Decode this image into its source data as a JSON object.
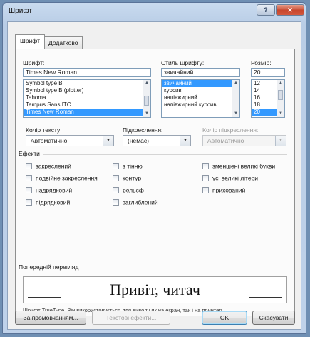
{
  "window": {
    "title": "Шрифт",
    "help_label": "?",
    "close_label": "✕"
  },
  "tabs": [
    {
      "label": "Шрифт"
    },
    {
      "label": "Додатково"
    }
  ],
  "font": {
    "label": "Шрифт:",
    "value": "Times New Roman",
    "items": [
      "Symbol type B",
      "Symbol type B (plotter)",
      "Tahoma",
      "Tempus Sans ITC",
      "Times New Roman"
    ],
    "selected_index": 4
  },
  "style": {
    "label": "Стиль шрифту:",
    "value": "звичайний",
    "items": [
      "звичайний",
      "курсив",
      "напівжирний",
      "напівжирний курсив"
    ],
    "selected_index": 0
  },
  "size": {
    "label": "Розмір:",
    "value": "20",
    "items": [
      "12",
      "14",
      "16",
      "18",
      "20"
    ],
    "selected_index": 4
  },
  "text_color": {
    "label": "Колір тексту:",
    "value": "Автоматично"
  },
  "underline": {
    "label": "Підкреслення:",
    "value": "(немає)"
  },
  "underline_color": {
    "label": "Колір підкреслення:",
    "value": "Автоматично"
  },
  "effects": {
    "title": "Ефекти",
    "col1": [
      "закреслений",
      "подвійне закреслення",
      "надрядковий",
      "підрядковий"
    ],
    "col2": [
      "з тінню",
      "контур",
      "рельєф",
      "заглиблений"
    ],
    "col3": [
      "зменшені великі букви",
      "усі великі літери",
      "прихований"
    ]
  },
  "preview": {
    "title": "Попередній перегляд",
    "text": "Привіт, читач",
    "note": "Шрифт TrueType. Він використовується для виводу як на екран, так і на принтер."
  },
  "buttons": {
    "default": "За промовчанням...",
    "text_effects": "Текстові ефекти...",
    "ok": "OK",
    "cancel": "Скасувати"
  }
}
